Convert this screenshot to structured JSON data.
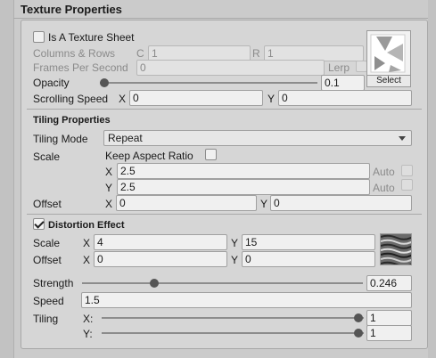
{
  "section_title": "Texture Properties",
  "texture_sheet": {
    "label": "Is A Texture Sheet",
    "checked": false
  },
  "columns_rows": {
    "label": "Columns & Rows",
    "c_label": "C",
    "c_value": "1",
    "r_label": "R",
    "r_value": "1"
  },
  "fps": {
    "label": "Frames Per Second",
    "value": "0",
    "lerp_label": "Lerp"
  },
  "preview": {
    "select_label": "Select"
  },
  "opacity": {
    "label": "Opacity",
    "value": "0.1",
    "fraction": 0.1
  },
  "scrolling_speed": {
    "label": "Scrolling Speed",
    "x_label": "X",
    "x_value": "0",
    "y_label": "Y",
    "y_value": "0"
  },
  "tiling_header": "Tiling Properties",
  "tiling_mode": {
    "label": "Tiling Mode",
    "value": "Repeat"
  },
  "scale": {
    "label": "Scale",
    "keep_aspect_label": "Keep Aspect Ratio",
    "x_label": "X",
    "x_value": "2.5",
    "y_label": "Y",
    "y_value": "2.5",
    "auto_label": "Auto"
  },
  "offset": {
    "label": "Offset",
    "x_label": "X",
    "x_value": "0",
    "y_label": "Y",
    "y_value": "0"
  },
  "distortion": {
    "label": "Distortion Effect",
    "checked": true,
    "scale_label": "Scale",
    "scale_x": "4",
    "scale_y": "15",
    "offset_label": "Offset",
    "offset_x": "0",
    "offset_y": "0",
    "x_label": "X",
    "y_label": "Y",
    "strength_label": "Strength",
    "strength_value": "0.246",
    "speed_label": "Speed",
    "speed_value": "1.5",
    "tiling_label": "Tiling",
    "tiling_x_label": "X:",
    "tiling_x_value": "1",
    "tiling_y_label": "Y:",
    "tiling_y_value": "1"
  }
}
